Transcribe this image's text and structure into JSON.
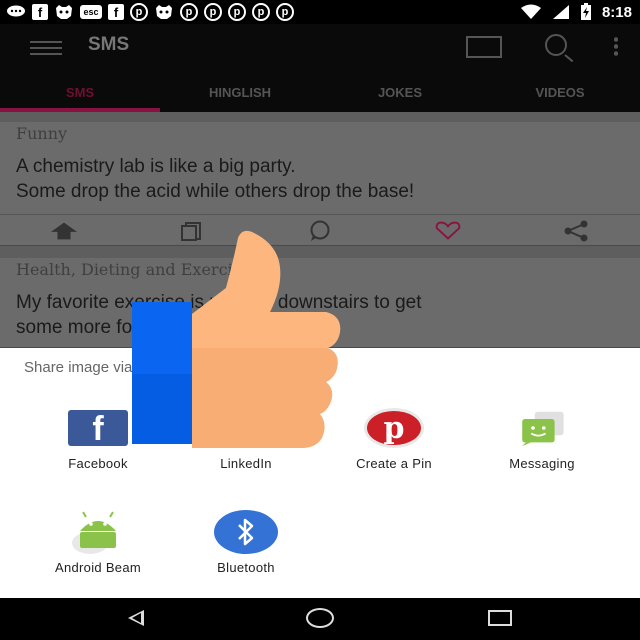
{
  "status_bar": {
    "time": "8:18",
    "notification_icons": [
      "chat-bubble-icon",
      "facebook-icon",
      "game-controller-icon",
      "esc-box-icon",
      "facebook-icon",
      "pinterest-icon",
      "game-controller-icon",
      "pinterest-icon",
      "pinterest-icon",
      "pinterest-icon",
      "pinterest-icon",
      "pinterest-icon"
    ],
    "esc_label": "esc",
    "fb_glyph": "f",
    "pin_glyph": "p",
    "controller_glyph": "▾"
  },
  "app_bar": {
    "title": "SMS",
    "tabs": [
      {
        "label": "SMS",
        "active": true
      },
      {
        "label": "HINGLISH",
        "active": false
      },
      {
        "label": "JOKES",
        "active": false
      },
      {
        "label": "VIDEOS",
        "active": false
      }
    ]
  },
  "cards": [
    {
      "category": "Funny",
      "text_lines": [
        "A chemistry lab is like a big party.",
        "Some drop the acid while others drop the base!"
      ]
    },
    {
      "category": "Health, Dieting and Exercise",
      "text_lines": [
        "My favorite exercise is running downstairs to get",
        "some more food."
      ]
    }
  ],
  "share_sheet": {
    "title": "Share image via",
    "items": [
      {
        "label": "Facebook",
        "icon": "facebook-icon"
      },
      {
        "label": "LinkedIn",
        "icon": "linkedin-icon"
      },
      {
        "label": "Create a Pin",
        "icon": "pinterest-icon"
      },
      {
        "label": "Messaging",
        "icon": "messaging-icon"
      },
      {
        "label": "Android Beam",
        "icon": "android-icon"
      },
      {
        "label": "Bluetooth",
        "icon": "bluetooth-icon"
      }
    ]
  },
  "colors": {
    "accent": "#8a1240",
    "facebook": "#3b5998",
    "pinterest": "#cb2027",
    "bluetooth": "#3572d6",
    "thumb_skin": "#f7ad73",
    "thumb_sleeve": "#0a66f0"
  }
}
